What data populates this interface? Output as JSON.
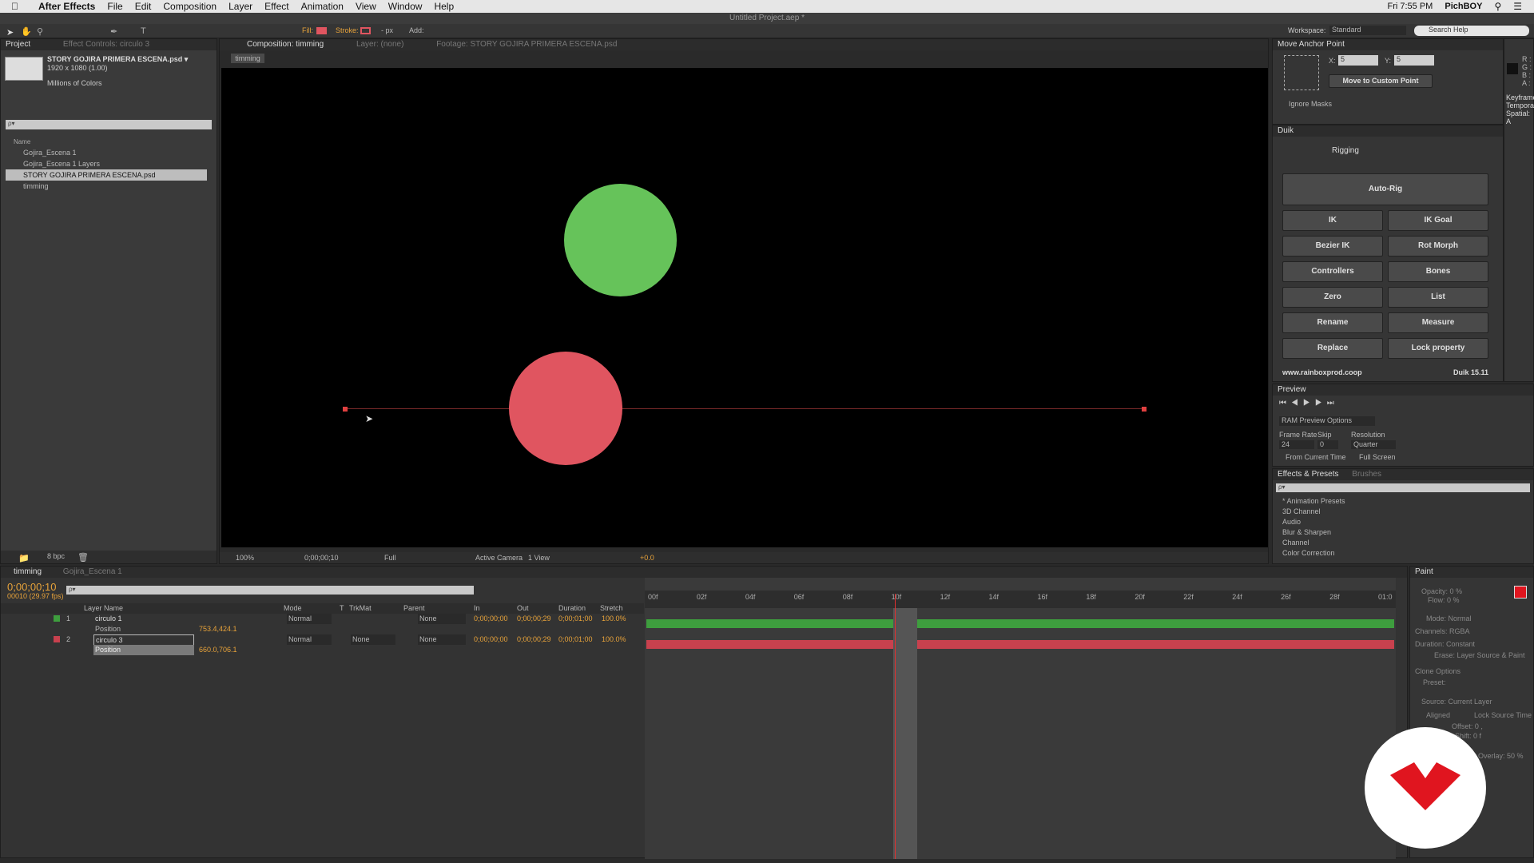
{
  "menubar": {
    "app": "After Effects",
    "items": [
      "File",
      "Edit",
      "Composition",
      "Layer",
      "Effect",
      "Animation",
      "View",
      "Window",
      "Help"
    ],
    "clock": "Fri 7:55 PM",
    "user": "PichBOY"
  },
  "window_title": "Untitled Project.aep *",
  "toolbar": {
    "fill_label": "Fill:",
    "stroke_label": "Stroke:",
    "px_label": "- px",
    "add_label": "Add:",
    "workspace_label": "Workspace:",
    "workspace_value": "Standard",
    "search_help": "Search Help"
  },
  "project": {
    "tab": "Project",
    "tab2": "Effect Controls: circulo 3",
    "item_name": "STORY GOJIRA PRIMERA ESCENA.psd ▾",
    "item_dims": "1920 x 1080 (1.00)",
    "item_colors": "Millions of Colors",
    "search_placeholder": "ρ▾",
    "col_name": "Name",
    "items": [
      "Gojira_Escena 1",
      "Gojira_Escena 1 Layers",
      "STORY GOJIRA PRIMERA ESCENA.psd",
      "timming"
    ],
    "bpc": "8 bpc"
  },
  "comp": {
    "tab": "Composition: timming",
    "tab_layer": "Layer: (none)",
    "tab_footage": "Footage: STORY GOJIRA PRIMERA ESCENA.psd",
    "sub_tab": "timming",
    "zoom": "100%",
    "timecode": "0;00;00;10",
    "resolution": "Full",
    "camera": "Active Camera",
    "views": "1 View",
    "exposure": "+0.0"
  },
  "anchor": {
    "title": "Move Anchor Point",
    "x_label": "X:",
    "x_value": "5",
    "y_label": "Y:",
    "y_value": "5",
    "move_button": "Move to Custom Point",
    "ignore_masks": "Ignore Masks"
  },
  "info_panel": {
    "r": "R :",
    "g": "G :",
    "b": "B :",
    "a": "A :",
    "keyframe": "Keyframe",
    "temporal": "Tempora",
    "spatial": "Spatial: A"
  },
  "duik": {
    "tab": "Duik",
    "section": "Rigging",
    "autorig": "Auto-Rig",
    "buttons": [
      "IK",
      "IK Goal",
      "Bezier IK",
      "Rot Morph",
      "Controllers",
      "Bones",
      "Zero",
      "List",
      "Rename",
      "Measure",
      "Replace",
      "Lock property"
    ],
    "website": "www.rainboxprod.coop",
    "version": "Duik 15.11"
  },
  "preview": {
    "tab": "Preview",
    "ram_options": "RAM Preview Options",
    "frame_rate_label": "Frame Rate",
    "frame_rate": "24",
    "skip_label": "Skip",
    "skip": "0",
    "resolution_label": "Resolution",
    "resolution": "Quarter",
    "from_current": "From Current Time",
    "full_screen": "Full Screen"
  },
  "effects": {
    "tab": "Effects & Presets",
    "tab2": "Brushes",
    "search": "ρ▾",
    "items": [
      "* Animation Presets",
      "3D Channel",
      "Audio",
      "Blur & Sharpen",
      "Channel",
      "Color Correction"
    ]
  },
  "timeline": {
    "tab": "timming",
    "tab2": "Gojira_Escena 1",
    "timecode": "0;00;00;10",
    "fps": "00010 (29.97 fps)",
    "search": "ρ▾",
    "headers": {
      "layer_name": "Layer Name",
      "mode": "Mode",
      "t": "T",
      "trkmat": "TrkMat",
      "parent": "Parent",
      "in": "In",
      "out": "Out",
      "duration": "Duration",
      "stretch": "Stretch"
    },
    "layers": [
      {
        "num": "1",
        "name": "circulo 1",
        "mode": "Normal",
        "trkmat": "",
        "parent": "None",
        "in": "0;00;00;00",
        "out": "0;00;00;29",
        "duration": "0;00;01;00",
        "stretch": "100.0%",
        "prop": "Position",
        "prop_value": "753.4,424.1",
        "color": "#3e9e3e"
      },
      {
        "num": "2",
        "name": "circulo 3",
        "mode": "Normal",
        "trkmat": "None",
        "parent": "None",
        "in": "0;00;00;00",
        "out": "0;00;00;29",
        "duration": "0;00;01;00",
        "stretch": "100.0%",
        "prop": "Position",
        "prop_value": "660.0,706.1",
        "color": "#c8414e"
      }
    ],
    "ruler": [
      "00f",
      "02f",
      "04f",
      "06f",
      "08f",
      "10f",
      "12f",
      "14f",
      "16f",
      "18f",
      "20f",
      "22f",
      "24f",
      "26f",
      "28f",
      "01:0"
    ],
    "current_time_fraction": 0.333
  },
  "paint": {
    "tab": "Paint",
    "opacity": "Opacity: 0 %",
    "flow": "Flow: 0 %",
    "mode": "Mode: Normal",
    "channels": "Channels: RGBA",
    "duration": "Duration: Constant",
    "erase": "Erase: Layer Source & Paint",
    "clone_options": "Clone Options",
    "preset": "Preset:",
    "source": "Source: Current Layer",
    "aligned": "Aligned",
    "lock_source": "Lock Source Time",
    "offset": "Offset: 0 ,",
    "shift": "Shift: 0 f",
    "source_overlay": "Source Overlay: 50 %"
  },
  "colors": {
    "green_circle": "#66c35a",
    "red_circle": "#e05560",
    "accent_orange": "#e8a33a",
    "logo_red": "#e0151f"
  }
}
